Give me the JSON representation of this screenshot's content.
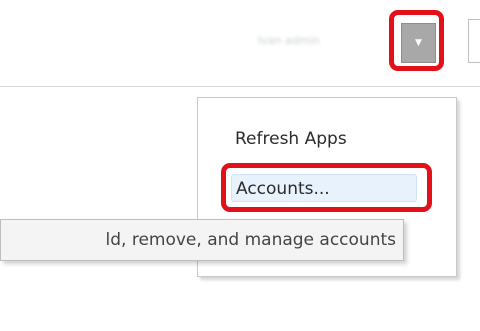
{
  "header": {
    "user_name": "Ivan admin",
    "dropdown_icon": "chevron-down-icon"
  },
  "menu": {
    "items": [
      {
        "label": "Refresh Apps"
      },
      {
        "label": "Accounts..."
      }
    ]
  },
  "tooltip": {
    "text": "ld, remove, and manage accounts"
  },
  "colors": {
    "highlight": "#e3101a",
    "selected_item_bg": "#e8f2fc",
    "button_bg": "#a8a8a8"
  }
}
